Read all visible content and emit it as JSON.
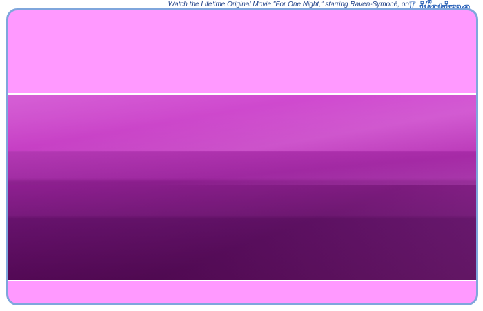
{
  "promo": {
    "text": "Watch the Lifetime Original Movie \"For One Night,\" starring Raven-Symoné, on"
  },
  "logo": {
    "text": "Lifetime",
    "mark": "®"
  },
  "colors": {
    "frame_border": "#7fa6dc",
    "frame_fill": "#ff99ff",
    "band_top": "#d04ad0",
    "band_bottom": "#5a0a5c",
    "promo_text": "#1e3f86",
    "logo_outline": "#2c63b8"
  }
}
